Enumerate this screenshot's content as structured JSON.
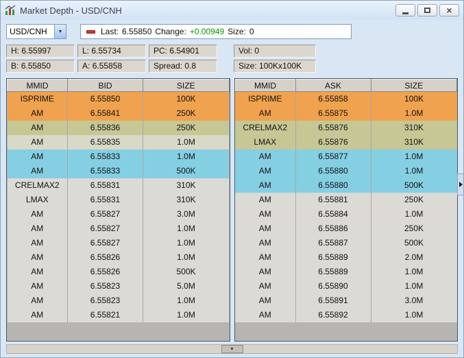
{
  "window": {
    "title": "Market Depth - USD/CNH",
    "close_glyph": "×"
  },
  "icons": {
    "app": "candlestick-chart-icon",
    "symbol_dropdown": "chevron-down-icon",
    "last_indicator": "red-dash-icon",
    "pane_expander": "right-arrow-icon",
    "scrollbar_thumb": "down-arrow-icon"
  },
  "toolbar": {
    "symbol": "USD/CNH",
    "dropdown_glyph": "▼",
    "last_label": "Last:",
    "last_value": "6.55850",
    "change_label": "Change:",
    "change_value": "+0.00949",
    "change_color": "#0a9b06",
    "size_label": "Size:",
    "size_value": "0"
  },
  "stats": {
    "row1": [
      {
        "label": "H:",
        "value": "6.55997"
      },
      {
        "label": "L:",
        "value": "6.55734"
      },
      {
        "label": "PC:",
        "value": "6.54901"
      },
      {
        "label": "Vol:",
        "value": "0"
      }
    ],
    "row2": [
      {
        "label": "B:",
        "value": "6.55850"
      },
      {
        "label": "A:",
        "value": "6.55858"
      },
      {
        "label": "Spread:",
        "value": "0.8"
      },
      {
        "label": "Size:",
        "value": "100Kx100K"
      }
    ]
  },
  "level_colors": {
    "orange": "#F0A24E",
    "khaki": "#C6C794",
    "pale_khaki": "#D8D9C6",
    "cyan": "#85CFE3",
    "gray": "#DBDAD5"
  },
  "bid_table": {
    "headers": [
      "MMID",
      "BID",
      "SIZE"
    ],
    "rows": [
      {
        "mmid": "ISPRIME",
        "price": "6.55850",
        "size": "100K",
        "color": "#F0A24E"
      },
      {
        "mmid": "AM",
        "price": "6.55841",
        "size": "250K",
        "color": "#F0A24E"
      },
      {
        "mmid": "AM",
        "price": "6.55836",
        "size": "250K",
        "color": "#C6C794"
      },
      {
        "mmid": "AM",
        "price": "6.55835",
        "size": "1.0M",
        "color": "#D8D9C6"
      },
      {
        "mmid": "AM",
        "price": "6.55833",
        "size": "1.0M",
        "color": "#85CFE3"
      },
      {
        "mmid": "AM",
        "price": "6.55833",
        "size": "500K",
        "color": "#85CFE3"
      },
      {
        "mmid": "CRELMAX2",
        "price": "6.55831",
        "size": "310K",
        "color": "#DBDAD5"
      },
      {
        "mmid": "LMAX",
        "price": "6.55831",
        "size": "310K",
        "color": "#DBDAD5"
      },
      {
        "mmid": "AM",
        "price": "6.55827",
        "size": "3.0M",
        "color": "#DBDAD5"
      },
      {
        "mmid": "AM",
        "price": "6.55827",
        "size": "1.0M",
        "color": "#DBDAD5"
      },
      {
        "mmid": "AM",
        "price": "6.55827",
        "size": "1.0M",
        "color": "#DBDAD5"
      },
      {
        "mmid": "AM",
        "price": "6.55826",
        "size": "1.0M",
        "color": "#DBDAD5"
      },
      {
        "mmid": "AM",
        "price": "6.55826",
        "size": "500K",
        "color": "#DBDAD5"
      },
      {
        "mmid": "AM",
        "price": "6.55823",
        "size": "5.0M",
        "color": "#DBDAD5"
      },
      {
        "mmid": "AM",
        "price": "6.55823",
        "size": "1.0M",
        "color": "#DBDAD5"
      },
      {
        "mmid": "AM",
        "price": "6.55821",
        "size": "1.0M",
        "color": "#DBDAD5"
      }
    ]
  },
  "ask_table": {
    "headers": [
      "MMID",
      "ASK",
      "SIZE"
    ],
    "rows": [
      {
        "mmid": "ISPRIME",
        "price": "6.55858",
        "size": "100K",
        "color": "#F0A24E"
      },
      {
        "mmid": "AM",
        "price": "6.55875",
        "size": "1.0M",
        "color": "#F0A24E"
      },
      {
        "mmid": "CRELMAX2",
        "price": "6.55876",
        "size": "310K",
        "color": "#C6C794"
      },
      {
        "mmid": "LMAX",
        "price": "6.55876",
        "size": "310K",
        "color": "#C6C794"
      },
      {
        "mmid": "AM",
        "price": "6.55877",
        "size": "1.0M",
        "color": "#85CFE3"
      },
      {
        "mmid": "AM",
        "price": "6.55880",
        "size": "1.0M",
        "color": "#85CFE3"
      },
      {
        "mmid": "AM",
        "price": "6.55880",
        "size": "500K",
        "color": "#85CFE3"
      },
      {
        "mmid": "AM",
        "price": "6.55881",
        "size": "250K",
        "color": "#DBDAD5"
      },
      {
        "mmid": "AM",
        "price": "6.55884",
        "size": "1.0M",
        "color": "#DBDAD5"
      },
      {
        "mmid": "AM",
        "price": "6.55886",
        "size": "250K",
        "color": "#DBDAD5"
      },
      {
        "mmid": "AM",
        "price": "6.55887",
        "size": "500K",
        "color": "#DBDAD5"
      },
      {
        "mmid": "AM",
        "price": "6.55889",
        "size": "2.0M",
        "color": "#DBDAD5"
      },
      {
        "mmid": "AM",
        "price": "6.55889",
        "size": "1.0M",
        "color": "#DBDAD5"
      },
      {
        "mmid": "AM",
        "price": "6.55890",
        "size": "1.0M",
        "color": "#DBDAD5"
      },
      {
        "mmid": "AM",
        "price": "6.55891",
        "size": "3.0M",
        "color": "#DBDAD5"
      },
      {
        "mmid": "AM",
        "price": "6.55892",
        "size": "1.0M",
        "color": "#DBDAD5"
      }
    ]
  }
}
